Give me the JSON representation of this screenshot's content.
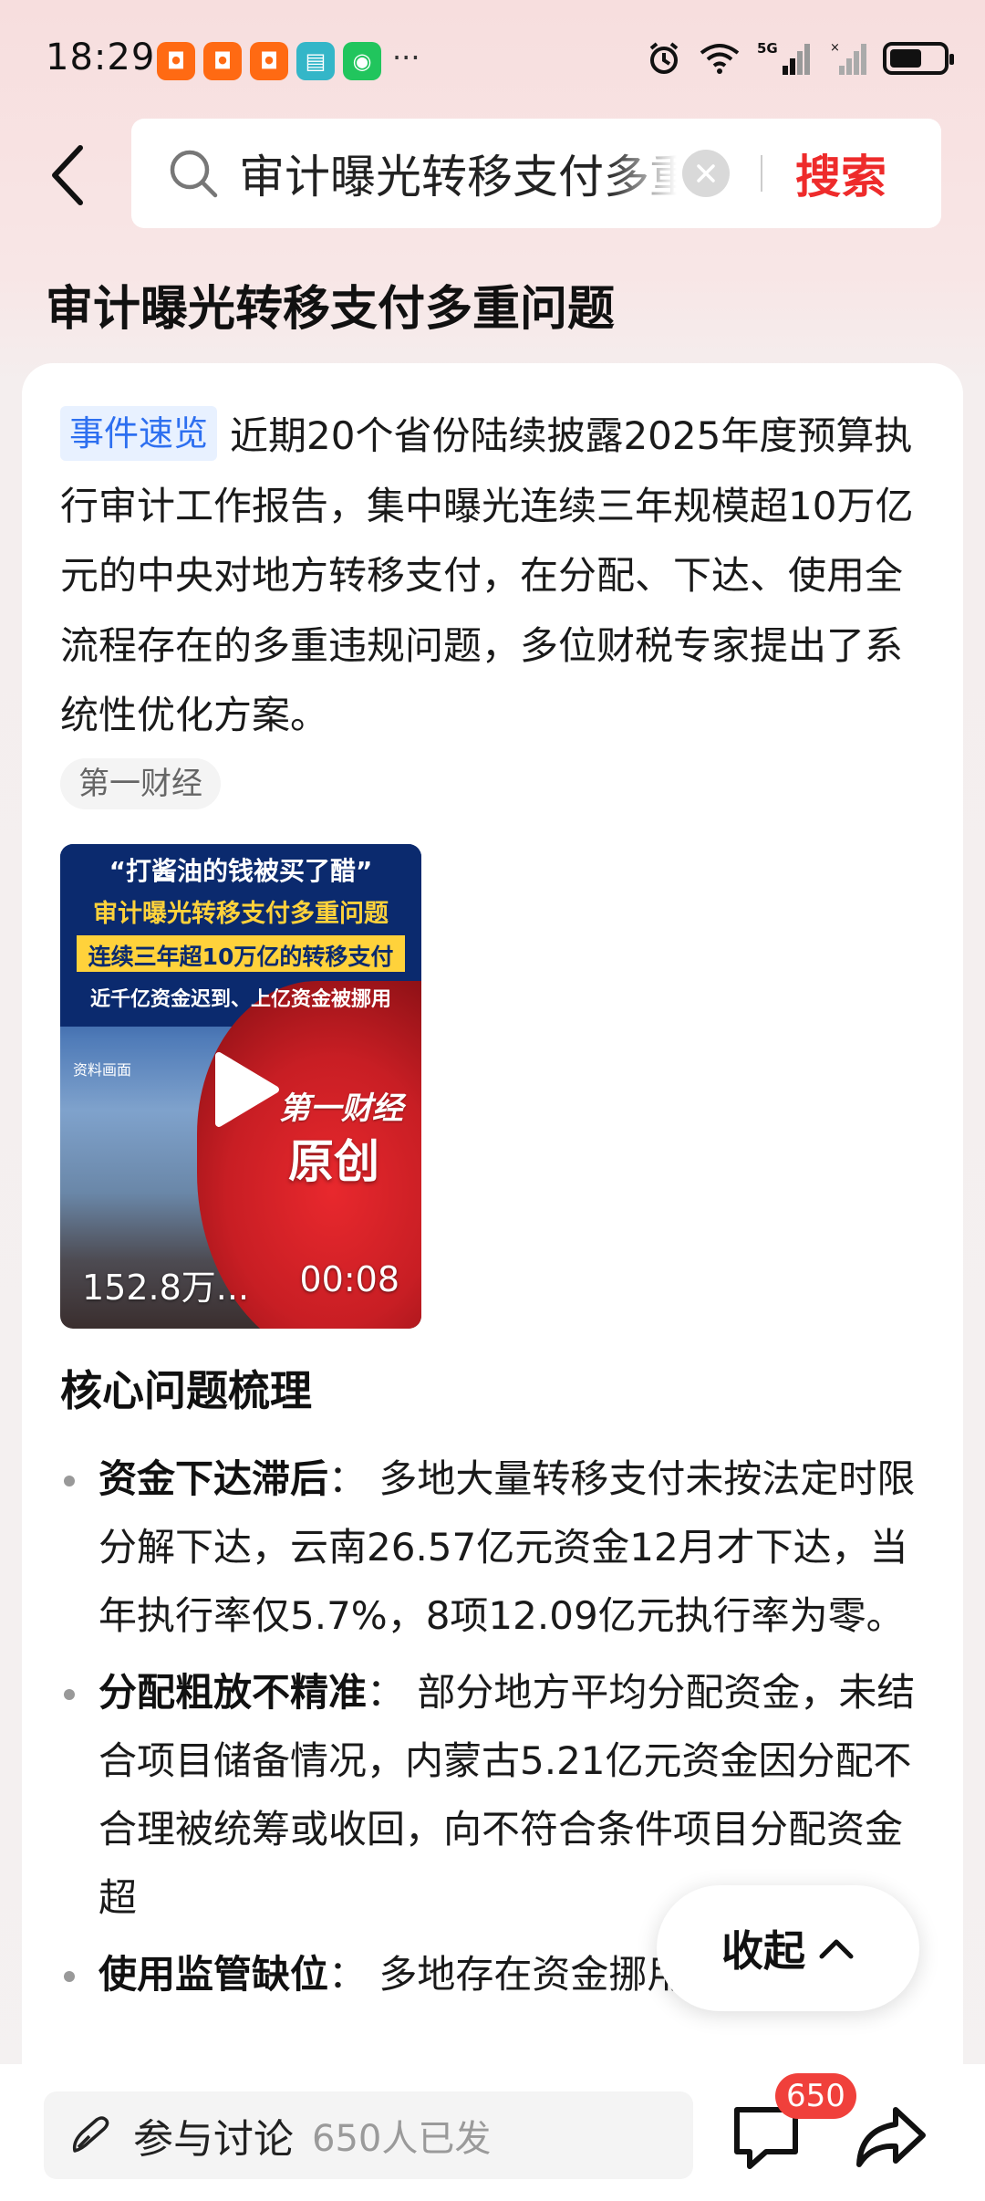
{
  "status_bar": {
    "time": "18:29",
    "app_icons": [
      "xiaohongshu",
      "xiaohongshu",
      "xiaohongshu",
      "book",
      "wechat"
    ],
    "more": "···",
    "network": "5G",
    "battery_level": 0.6
  },
  "header": {
    "search_query": "审计曝光转移支付多重问题",
    "search_button": "搜索"
  },
  "page_title": "审计曝光转移支付多重问题",
  "summary": {
    "badge": "事件速览",
    "text": "近期20个省份陆续披露2025年度预算执行审计工作报告，集中曝光连续三年规模超10万亿元的中央对地方转移支付，在分配、下达、使用全流程存在的多重违规问题，多位财税专家提出了系统性优化方案。",
    "source": "第一财经"
  },
  "video": {
    "line1": "“打酱油的钱被买了醋”",
    "line2": "审计曝光转移支付多重问题",
    "line3": "连续三年超10万亿的转移支付",
    "line4": "近千亿资金迟到、上亿资金被挪用",
    "source_note": "资料画面",
    "logo": "第一财经",
    "original": "原创",
    "views": "152.8万...",
    "duration": "00:08"
  },
  "section": {
    "title": "核心问题梳理",
    "items": [
      {
        "head": "资金下达滞后",
        "sep": "：",
        "body": "多地大量转移支付未按法定时限分解下达，云南26.57亿元资金12月才下达，当年执行率仅5.7%，8项12.09亿元执行率为零。"
      },
      {
        "head": "分配粗放不精准",
        "sep": "：",
        "body": "部分地方平均分配资金，未结合项目储备情况，内蒙古5.21亿元资金因分配不合理被统筹或收回，向不符合条件项目分配资金超"
      },
      {
        "head": "使用监管缺位",
        "sep": "：",
        "body": "多地存在资金挪用、闲"
      }
    ]
  },
  "collapse_button": "收起",
  "bottom_bar": {
    "discuss_label": "参与讨论",
    "discuss_count": "650人已发",
    "comment_badge": "650"
  },
  "colors": {
    "accent": "#ee2b2b",
    "badge_blue": "#2d6ff0",
    "badge_red": "#f0403b"
  }
}
